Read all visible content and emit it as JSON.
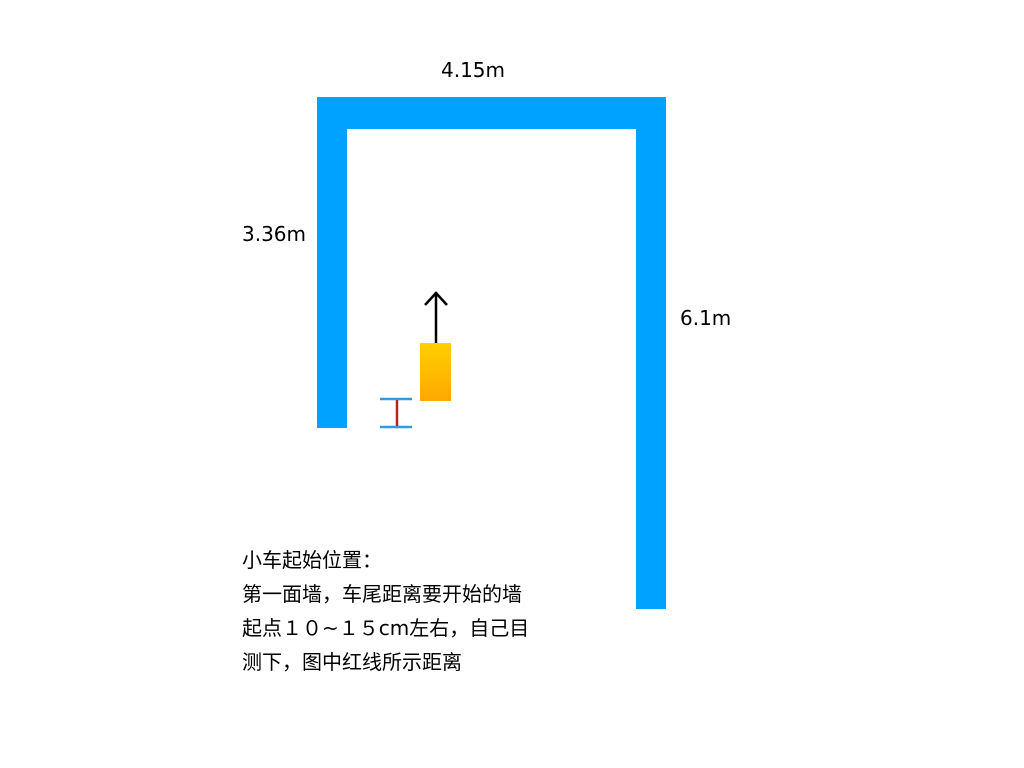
{
  "colors": {
    "wall": "#00a2ff",
    "car_top": "#ffd000",
    "car_bottom": "#ffa800",
    "marker_bars": "#2e9be5",
    "marker_line": "#b3261e",
    "arrow": "#000000"
  },
  "dimensions": {
    "top_wall": "4.15m",
    "left_wall": "3.36m",
    "right_wall": "6.1m"
  },
  "note": {
    "lines": [
      "小车起始位置：",
      "第一面墙，车尾距离要开始的墙",
      "起点１０~１５cm左右，自己目",
      "测下，图中红线所示距离"
    ]
  },
  "icons": {
    "arrow": "up-arrow-icon",
    "marker": "distance-marker-icon"
  }
}
